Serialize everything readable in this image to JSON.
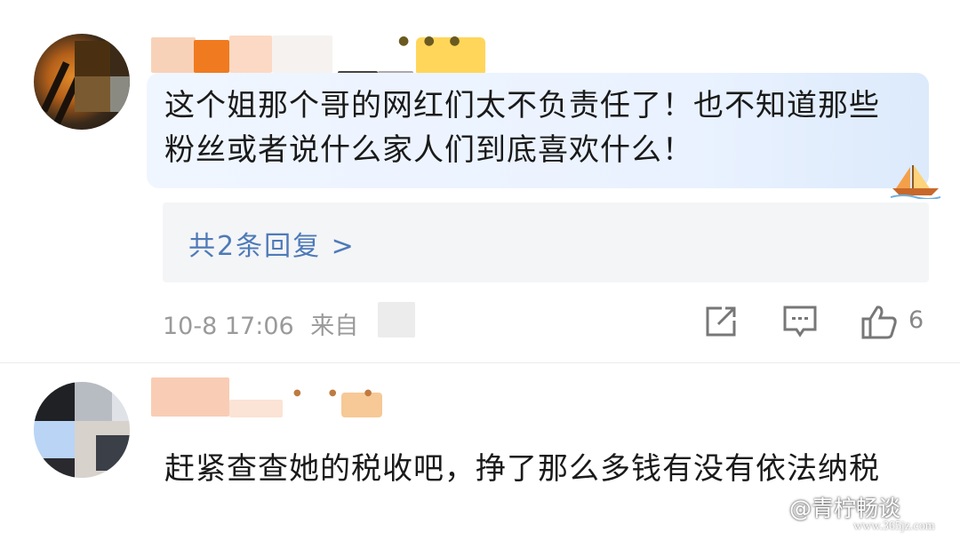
{
  "comments": [
    {
      "text": "这个姐那个哥的网红们太不负责任了！也不知道那些粉丝或者说什么家人们到底喜欢什么！",
      "reply_link": "共2条回复 >",
      "timestamp": "10-8 17:06",
      "source_prefix": "来自",
      "actions": [
        "share-icon",
        "comment-icon",
        "like-icon"
      ],
      "like_count": "6"
    },
    {
      "text": "赶紧查查她的税收吧，挣了那么多钱有没有依法纳税"
    }
  ],
  "watermark": {
    "label": "@青柠畅谈",
    "url": "www.365jz.com"
  },
  "colors": {
    "link": "#4e7ab8",
    "meta": "#9a9a9a",
    "bubble": "#eaf2ff"
  }
}
